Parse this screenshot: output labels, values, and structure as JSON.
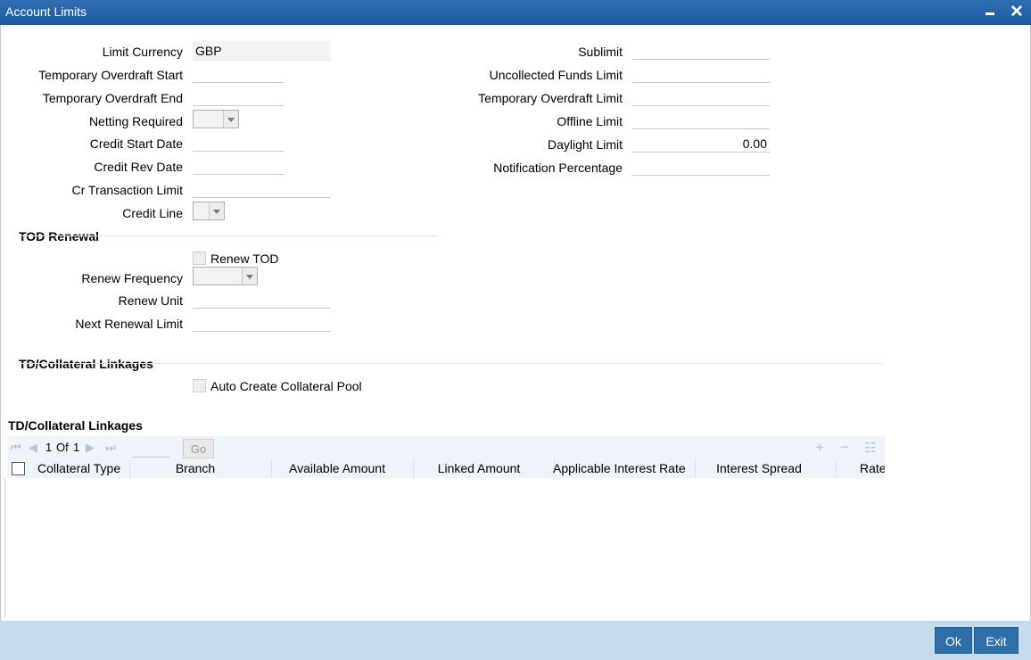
{
  "window": {
    "title": "Account Limits"
  },
  "left_fields": {
    "limit_currency": {
      "label": "Limit Currency",
      "value": "GBP"
    },
    "tod_start": {
      "label": "Temporary Overdraft Start",
      "value": ""
    },
    "tod_end": {
      "label": "Temporary Overdraft End",
      "value": ""
    },
    "netting_required": {
      "label": "Netting Required",
      "value": ""
    },
    "credit_start_date": {
      "label": "Credit Start Date",
      "value": ""
    },
    "credit_rev_date": {
      "label": "Credit Rev Date",
      "value": ""
    },
    "cr_transaction_limit": {
      "label": "Cr Transaction Limit",
      "value": ""
    },
    "credit_line": {
      "label": "Credit Line",
      "value": ""
    }
  },
  "right_fields": {
    "sublimit": {
      "label": "Sublimit",
      "value": ""
    },
    "uncollected_funds_limit": {
      "label": "Uncollected Funds Limit",
      "value": ""
    },
    "tod_limit": {
      "label": "Temporary Overdraft Limit",
      "value": ""
    },
    "offline_limit": {
      "label": "Offline Limit",
      "value": ""
    },
    "daylight_limit": {
      "label": "Daylight Limit",
      "value": "0.00"
    },
    "notification_percentage": {
      "label": "Notification Percentage",
      "value": ""
    }
  },
  "tod_renewal": {
    "title": "TOD Renewal",
    "renew_tod_label": "Renew TOD",
    "renew_frequency_label": "Renew Frequency",
    "renew_unit_label": "Renew Unit",
    "next_renewal_limit_label": "Next Renewal Limit"
  },
  "td_collateral": {
    "title": "TD/Collateral Linkages",
    "auto_create_label": "Auto Create Collateral Pool"
  },
  "grid": {
    "title": "TD/Collateral Linkages",
    "pagination": {
      "current": "1",
      "of_label": "Of",
      "total": "1",
      "go_label": "Go"
    },
    "columns": [
      "Collateral Type",
      "Branch",
      "Available Amount",
      "Linked Amount",
      "Applicable Interest Rate",
      "Interest Spread",
      "Rate"
    ]
  },
  "footer": {
    "ok_label": "Ok",
    "exit_label": "Exit"
  },
  "colors": {
    "titlebar": "#2f6db5",
    "footer": "#c6dcee",
    "button": "#2f6fa9"
  }
}
